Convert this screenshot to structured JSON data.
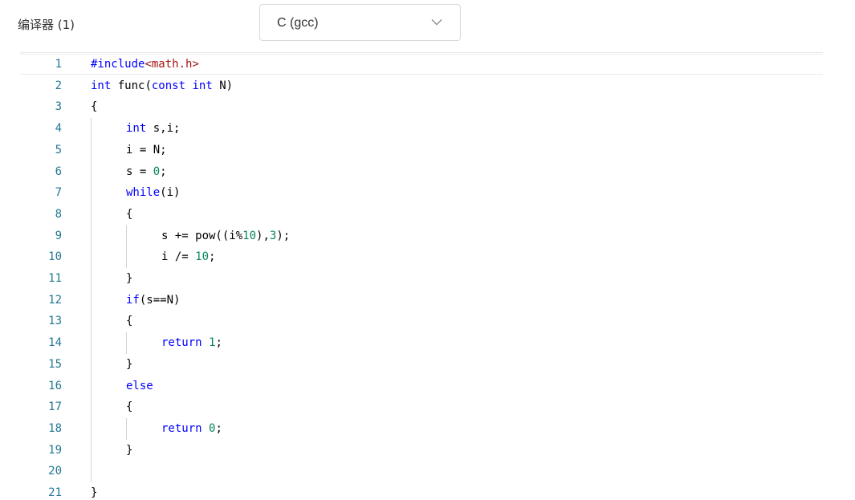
{
  "header": {
    "compiler_label": "编译器 (1)",
    "compiler_selected": "C (gcc)"
  },
  "editor": {
    "current_line": 1,
    "lines": [
      {
        "n": "1",
        "indent": 0,
        "tokens": [
          {
            "t": "#include",
            "c": "pre"
          },
          {
            "t": "<math.h>",
            "c": "str"
          }
        ]
      },
      {
        "n": "2",
        "indent": 0,
        "tokens": [
          {
            "t": "int",
            "c": "kw"
          },
          {
            "t": " func(",
            "c": ""
          },
          {
            "t": "const",
            "c": "kw"
          },
          {
            "t": " ",
            "c": ""
          },
          {
            "t": "int",
            "c": "kw"
          },
          {
            "t": " N)",
            "c": ""
          }
        ]
      },
      {
        "n": "3",
        "indent": 0,
        "tokens": [
          {
            "t": "{",
            "c": ""
          }
        ]
      },
      {
        "n": "4",
        "indent": 1,
        "tokens": [
          {
            "t": "int",
            "c": "kw"
          },
          {
            "t": " s,i;",
            "c": ""
          }
        ]
      },
      {
        "n": "5",
        "indent": 1,
        "tokens": [
          {
            "t": "i = N;",
            "c": ""
          }
        ]
      },
      {
        "n": "6",
        "indent": 1,
        "tokens": [
          {
            "t": "s = ",
            "c": ""
          },
          {
            "t": "0",
            "c": "num"
          },
          {
            "t": ";",
            "c": ""
          }
        ]
      },
      {
        "n": "7",
        "indent": 1,
        "tokens": [
          {
            "t": "while",
            "c": "kw"
          },
          {
            "t": "(i)",
            "c": ""
          }
        ]
      },
      {
        "n": "8",
        "indent": 1,
        "tokens": [
          {
            "t": "{",
            "c": ""
          }
        ]
      },
      {
        "n": "9",
        "indent": 2,
        "tokens": [
          {
            "t": "s += pow((i%",
            "c": ""
          },
          {
            "t": "10",
            "c": "num"
          },
          {
            "t": "),",
            "c": ""
          },
          {
            "t": "3",
            "c": "num"
          },
          {
            "t": ");",
            "c": ""
          }
        ]
      },
      {
        "n": "10",
        "indent": 2,
        "tokens": [
          {
            "t": "i /= ",
            "c": ""
          },
          {
            "t": "10",
            "c": "num"
          },
          {
            "t": ";",
            "c": ""
          }
        ]
      },
      {
        "n": "11",
        "indent": 1,
        "tokens": [
          {
            "t": "}",
            "c": ""
          }
        ]
      },
      {
        "n": "12",
        "indent": 1,
        "tokens": [
          {
            "t": "if",
            "c": "kw"
          },
          {
            "t": "(s==N)",
            "c": ""
          }
        ]
      },
      {
        "n": "13",
        "indent": 1,
        "tokens": [
          {
            "t": "{",
            "c": ""
          }
        ]
      },
      {
        "n": "14",
        "indent": 2,
        "tokens": [
          {
            "t": "return",
            "c": "kw"
          },
          {
            "t": " ",
            "c": ""
          },
          {
            "t": "1",
            "c": "num"
          },
          {
            "t": ";",
            "c": ""
          }
        ]
      },
      {
        "n": "15",
        "indent": 1,
        "tokens": [
          {
            "t": "}",
            "c": ""
          }
        ]
      },
      {
        "n": "16",
        "indent": 1,
        "tokens": [
          {
            "t": "else",
            "c": "kw"
          }
        ]
      },
      {
        "n": "17",
        "indent": 1,
        "tokens": [
          {
            "t": "{",
            "c": ""
          }
        ]
      },
      {
        "n": "18",
        "indent": 2,
        "tokens": [
          {
            "t": "return",
            "c": "kw"
          },
          {
            "t": " ",
            "c": ""
          },
          {
            "t": "0",
            "c": "num"
          },
          {
            "t": ";",
            "c": ""
          }
        ]
      },
      {
        "n": "19",
        "indent": 1,
        "tokens": [
          {
            "t": "}",
            "c": ""
          }
        ]
      },
      {
        "n": "20",
        "indent": 1,
        "tokens": []
      },
      {
        "n": "21",
        "indent": 0,
        "tokens": [
          {
            "t": "}",
            "c": ""
          }
        ]
      }
    ]
  },
  "colors": {
    "keyword": "#0000ff",
    "number": "#098658",
    "string": "#a31515",
    "line_number": "#237893"
  },
  "icons": {
    "select_arrow": "chevron-down-icon"
  }
}
